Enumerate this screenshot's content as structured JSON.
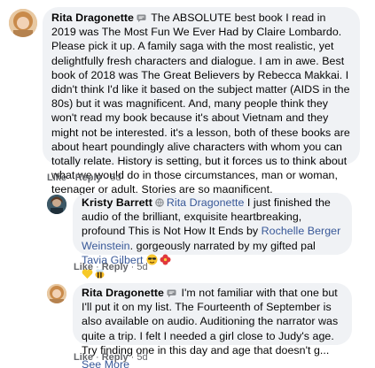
{
  "comments": [
    {
      "author": "Rita Dragonette",
      "text": " The ABSOLUTE best book I read in 2019 was The Most Fun We Ever Had by Claire Lombardo. Please pick it up. A family saga with the most realistic, yet delightfully fresh characters and dialogue. I am in awe. Best book of 2018 was The Great Believers by Rebecca Makkai. I didn't think I'd like it based on the subject matter (AIDS in the 80s) but it was magnificent. And, many people think they won't read my book because it's about Vietnam and they might not be interested. it's a lesson, both of these books are about heart poundingly alive characters with whom you can totally relate. History is setting, but it forces us to think about what we would do in those circumstances, man or woman, teenager or adult. Stories are so magnificent.",
      "like": "Like",
      "reply": "Reply",
      "time": "5d"
    },
    {
      "author": "Kristy Barrett",
      "mention": "Rita Dragonette",
      "text_a": " I just finished the audio of the brilliant, exquisite heartbreaking, profound This is Not How It Ends by ",
      "mention2": "Rochelle Berger Weinstein",
      "text_b": ". gorgeously narrated by my gifted pal ",
      "mention3": "Tavia Gilbert",
      "like": "Like",
      "reply": "Reply",
      "time": "5d"
    },
    {
      "author": "Rita Dragonette",
      "text": " I'm not familiar with that one but I'll put it on my list. The Fourteenth of September is also available on audio. Auditioning the narrator was quite a trip. I felt I needed a girl close to Judy's age. Try finding one in this day and age that doesn't g...",
      "see_more": "See More",
      "like": "Like",
      "reply": "Reply",
      "time": "5d"
    }
  ],
  "dot": "·"
}
